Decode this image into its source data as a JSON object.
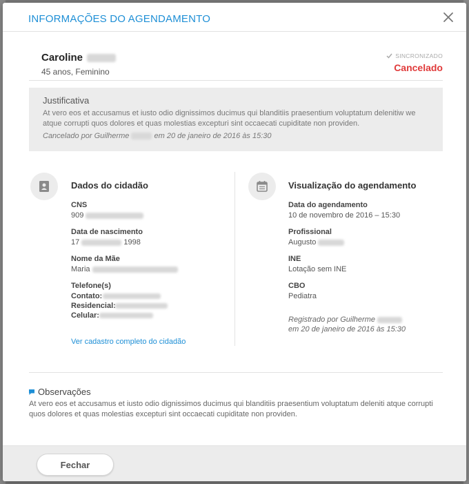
{
  "dialog": {
    "title": "INFORMAÇÕES DO AGENDAMENTO",
    "close_icon": "close-icon"
  },
  "patient": {
    "name": "Caroline",
    "info": "45 anos, Feminino",
    "sync_label": "SINCRONIZADO",
    "status": "Cancelado",
    "status_color": "#e03a3a"
  },
  "justification": {
    "title": "Justificativa",
    "text": "At vero eos et accusamus et iusto odio dignissimos ducimus qui blanditiis praesentium voluptatum delenitiw we atque corrupti quos dolores et quas molestias excepturi sint occaecati cupiditate non providen.",
    "cancel_prefix": "Cancelado por Guilherme",
    "cancel_suffix": "em 20 de janeiro de 2016 às 15:30"
  },
  "citizen": {
    "title": "Dados do cidadão",
    "icon": "id-card-icon",
    "cns_label": "CNS",
    "cns_value": "909",
    "birth_label": "Data de nascimento",
    "birth_day": "17",
    "birth_year": "1998",
    "mother_label": "Nome da Mãe",
    "mother_value": "Maria",
    "phone_label": "Telefone(s)",
    "phone_contact_label": "Contato:",
    "phone_home_label": "Residencial:",
    "phone_cell_label": "Celular:",
    "link_label": "Ver cadastro completo do cidadão"
  },
  "appointment": {
    "title": "Visualização do agendamento",
    "icon": "calendar-icon",
    "date_label": "Data do agendamento",
    "date_value": "10 de novembro de 2016 – 15:30",
    "professional_label": "Profissional",
    "professional_value": "Augusto",
    "ine_label": "INE",
    "ine_value": "Lotação sem INE",
    "cbo_label": "CBO",
    "cbo_value": "Pediatra",
    "registered_prefix": "Registrado por Guilherme",
    "registered_date": "em 20 de janeiro de 2016 às 15:30"
  },
  "observations": {
    "title": "Observações",
    "icon": "speech-bubble-icon",
    "text": "At vero eos et accusamus et iusto odio dignissimos ducimus qui blanditiis praesentium voluptatum deleniti atque corrupti quos dolores et quas molestias excepturi sint occaecati cupiditate non providen."
  },
  "footer": {
    "close_button": "Fechar"
  },
  "colors": {
    "accent": "#1e8fd6",
    "cancel": "#e03a3a"
  }
}
